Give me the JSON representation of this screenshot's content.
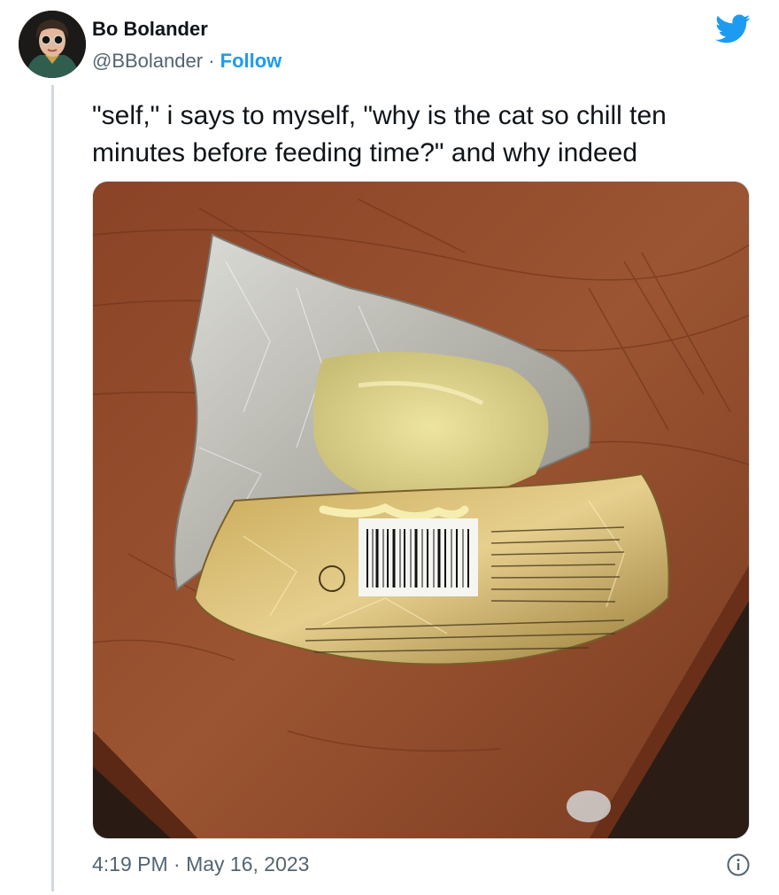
{
  "author": {
    "name": "Bo Bolander",
    "handle": "@BBolander",
    "separator": " · ",
    "follow_label": "Follow"
  },
  "tweet": {
    "text_lines": [
      "\"self,\" i says to myself, \"why is the cat so chill ten",
      "minutes before feeding time?\" and why indeed"
    ],
    "timestamp": "4:19 PM · May 16, 2023"
  },
  "icons": {
    "brand": "twitter-bird-icon",
    "info": "info-icon"
  },
  "colors": {
    "accent": "#1d9bf0",
    "text_primary": "#0f1419",
    "text_secondary": "#536471",
    "thread_line": "#cfd9de"
  }
}
